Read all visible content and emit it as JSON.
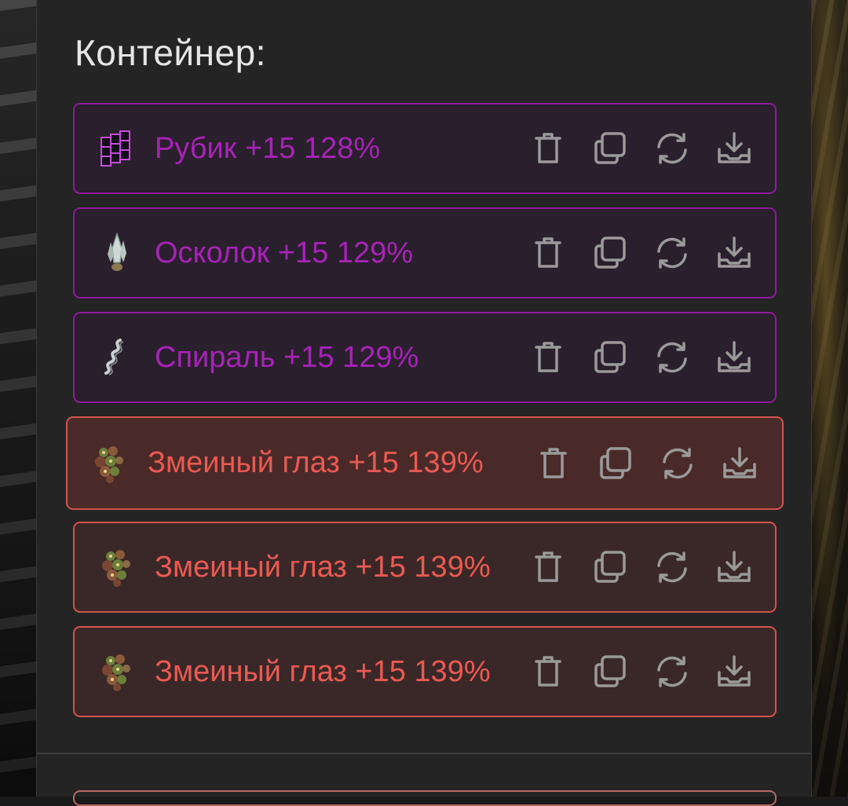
{
  "container": {
    "title": "Контейнер:",
    "items": [
      {
        "label": "Рубик +15 128%",
        "icon": "cube-icon",
        "rarity": "purple"
      },
      {
        "label": "Осколок +15 129%",
        "icon": "crystal-shard-icon",
        "rarity": "purple"
      },
      {
        "label": "Спираль +15 129%",
        "icon": "spiral-icon",
        "rarity": "purple"
      },
      {
        "label": "Змеиный глаз +15 139%",
        "icon": "snake-eye-icon",
        "rarity": "red"
      },
      {
        "label": "Змеиный глаз +15 139%",
        "icon": "snake-eye-icon",
        "rarity": "red"
      },
      {
        "label": "Змеиный глаз +15 139%",
        "icon": "snake-eye-icon",
        "rarity": "red"
      }
    ],
    "actions": [
      "trash-icon",
      "copy-icon",
      "refresh-icon",
      "download-icon"
    ]
  },
  "colors": {
    "purple_accent": "#8e1a9c",
    "purple_text": "#a822b8",
    "red_accent": "#d2534c",
    "red_text": "#ea5a52",
    "icon_gray": "#9a9a9a"
  }
}
